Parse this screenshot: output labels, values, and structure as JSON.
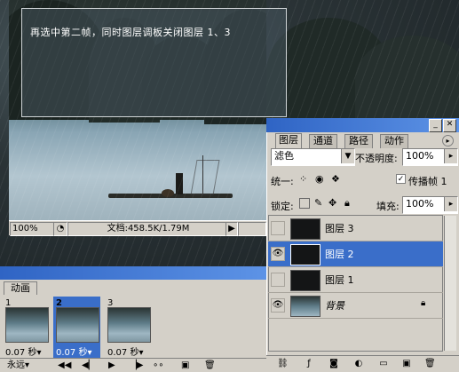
{
  "overlay": {
    "instruction": "再选中第二帧，同时图层调板关闭图层 1、3"
  },
  "document": {
    "zoom": "100%",
    "doc_info": "文档:458.5K/1.79M",
    "nav_arrow": "▶"
  },
  "layers_panel": {
    "tabs": [
      {
        "label": "图层",
        "active": true
      },
      {
        "label": "通道",
        "active": false
      },
      {
        "label": "路径",
        "active": false
      },
      {
        "label": "动作",
        "active": false
      }
    ],
    "blend_mode": "滤色",
    "opacity_label": "不透明度:",
    "opacity_value": "100%",
    "unify_label": "统一:",
    "propagate_label": "传播帧 1",
    "propagate_checked": true,
    "lock_label": "锁定:",
    "fill_label": "填充:",
    "fill_value": "100%",
    "layers": [
      {
        "name": "图层 3",
        "visible": false,
        "selected": false
      },
      {
        "name": "图层 2",
        "visible": true,
        "selected": true
      },
      {
        "name": "图层 1",
        "visible": false,
        "selected": false
      },
      {
        "name": "背景",
        "visible": true,
        "selected": false,
        "locked": true
      }
    ],
    "selection_color": "#3a6ec9"
  },
  "animation_panel": {
    "tab_label": "动画",
    "frames": [
      {
        "number": "1",
        "delay": "0.07 秒▾",
        "selected": false
      },
      {
        "number": "2",
        "delay": "0.07 秒▾",
        "selected": true
      },
      {
        "number": "3",
        "delay": "0.07 秒▾",
        "selected": false
      }
    ],
    "loop": "永远",
    "loop_arrow": "▾"
  },
  "icons": [
    "eye-icon",
    "lock-icon",
    "chain-link-icon",
    "trash-icon",
    "new-layer-icon",
    "play-icon",
    "first-frame-icon",
    "prev-frame-icon",
    "next-frame-icon",
    "tween-icon",
    "new-frame-icon"
  ]
}
